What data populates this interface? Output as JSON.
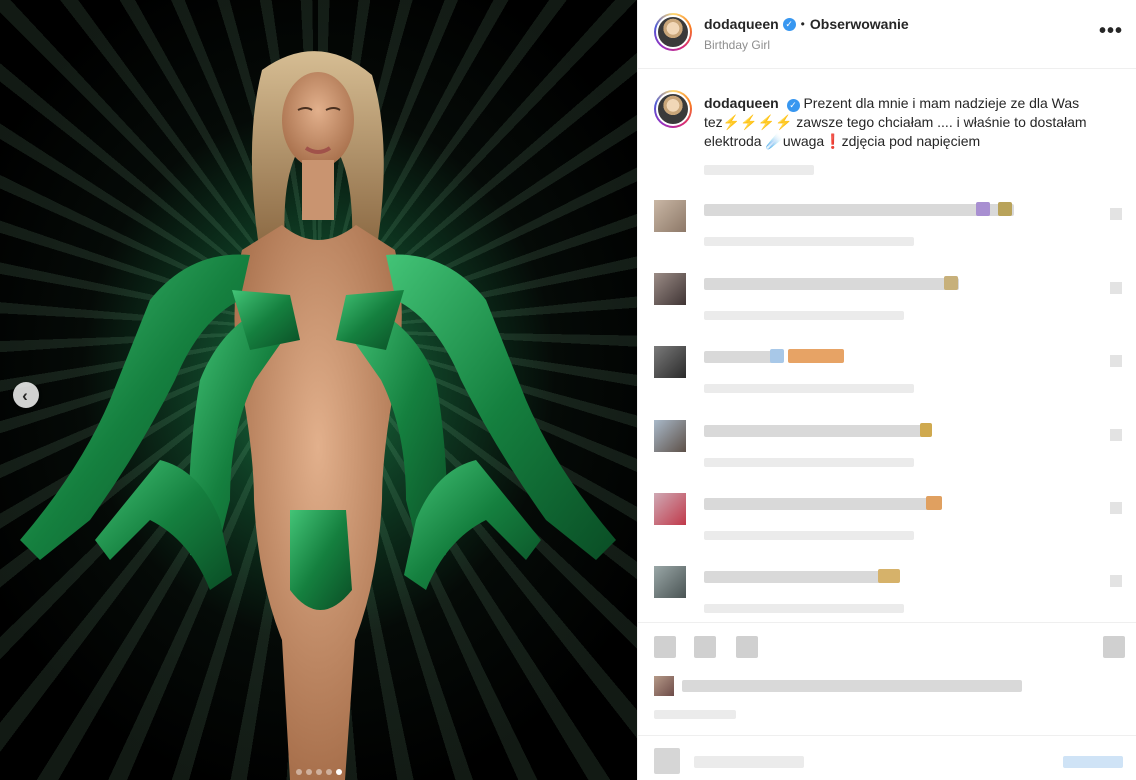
{
  "post": {
    "media": {
      "alt": "",
      "carousel": {
        "total": 5,
        "active": 5
      }
    },
    "header": {
      "username": "dodaqueen",
      "separator": "•",
      "follow_label": "Obserwowanie",
      "subtitle": "Birthday Girl",
      "more_icon": "more-options-icon"
    },
    "caption": {
      "username": "dodaqueen",
      "text_part1": "Prezent dla mnie i mam nadzieje ze dla Was tez",
      "emoji_bolts": "⚡⚡⚡⚡",
      "text_part2": " zawsze tego chciałam .... i właśnie to dostałam elektroda ",
      "emoji_comet": "☄️",
      "text_part3": "uwaga",
      "emoji_exclaim": "❗",
      "text_part4": "zdjęcia pod napięciem"
    },
    "colors": {
      "verified": "#3897f0",
      "muted_text": "#8e8e8e",
      "divider": "#efefef",
      "accent_green": "#1f9a55"
    }
  }
}
